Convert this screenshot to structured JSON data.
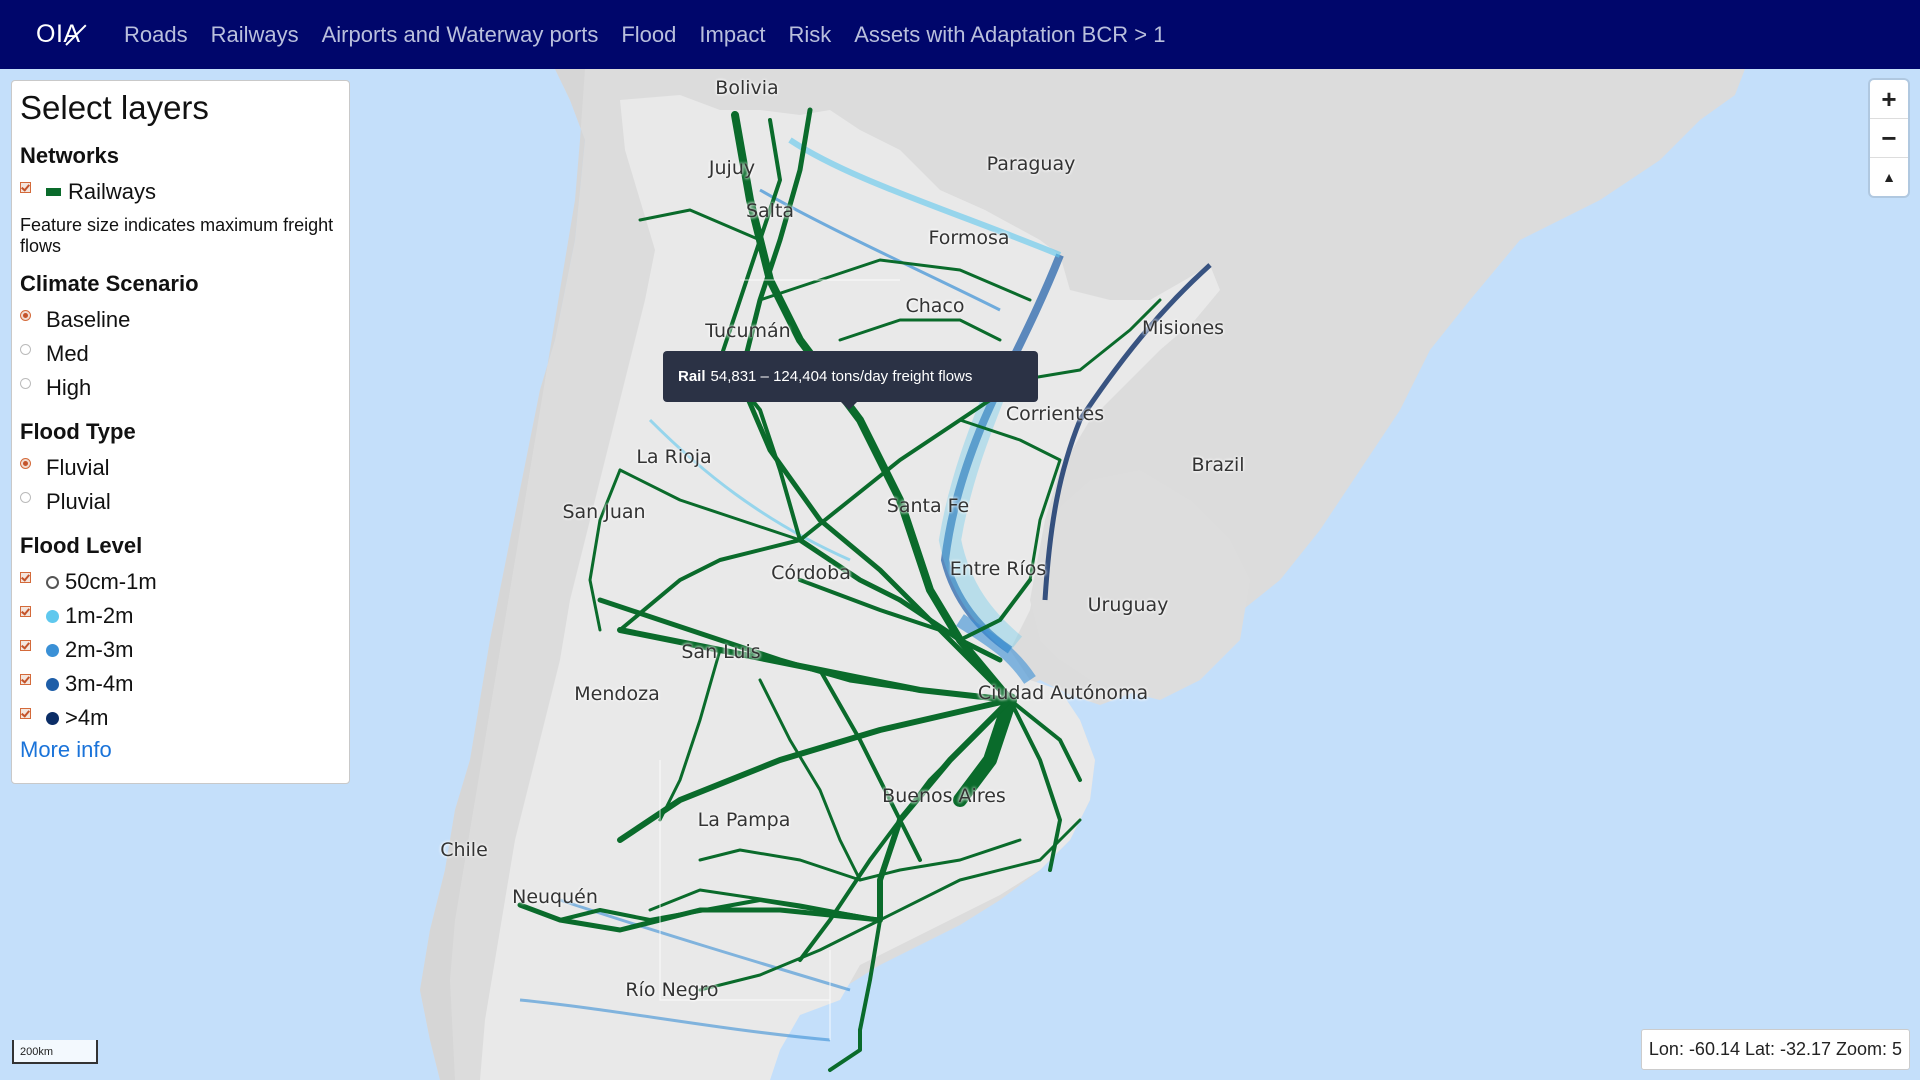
{
  "navbar": {
    "brand": "OIA",
    "links": [
      "Roads",
      "Railways",
      "Airports and Waterway ports",
      "Flood",
      "Impact",
      "Risk",
      "Assets with Adaptation BCR > 1"
    ]
  },
  "panel": {
    "title": "Select layers",
    "networks_heading": "Networks",
    "railways_label": "Railways",
    "railways_checked": true,
    "feature_note": "Feature size indicates maximum freight flows",
    "climate_heading": "Climate Scenario",
    "climate_options": [
      {
        "label": "Baseline",
        "selected": true
      },
      {
        "label": "Med",
        "selected": false
      },
      {
        "label": "High",
        "selected": false
      }
    ],
    "flood_type_heading": "Flood Type",
    "flood_type_options": [
      {
        "label": "Fluvial",
        "selected": true
      },
      {
        "label": "Pluvial",
        "selected": false
      }
    ],
    "flood_level_heading": "Flood Level",
    "flood_levels": [
      {
        "label": "50cm-1m",
        "color": "#ffffff",
        "checked": true
      },
      {
        "label": "1m-2m",
        "color": "#5fc8ee",
        "checked": true
      },
      {
        "label": "2m-3m",
        "color": "#3a90d6",
        "checked": true
      },
      {
        "label": "3m-4m",
        "color": "#1e5ea8",
        "checked": true
      },
      {
        "label": ">4m",
        "color": "#0b2d66",
        "checked": true
      }
    ],
    "more_info": "More info"
  },
  "zoom_controls": {
    "zoom_in": "+",
    "zoom_out": "−",
    "compass": "▲"
  },
  "tooltip": {
    "label": "Rail",
    "text": "54,831 – 124,404 tons/day freight flows"
  },
  "scale_bar": "200km",
  "coordinates": "Lon: -60.14 Lat: -32.17 Zoom: 5",
  "map_labels": {
    "bolivia": "Bolivia",
    "paraguay": "Paraguay",
    "jujuy": "Jujuy",
    "salta": "Salta",
    "formosa": "Formosa",
    "chaco": "Chaco",
    "tucuman": "Tucumán",
    "misiones": "Misiones",
    "corrientes": "Corrientes",
    "brazil": "Brazil",
    "la_rioja": "La Rioja",
    "santa_fe": "Santa Fe",
    "san_juan": "San Juan",
    "entre_rios": "Entre Ríos",
    "cordoba": "Córdoba",
    "uruguay": "Uruguay",
    "san_luis": "San Luis",
    "ciudad_autonoma": "Ciudad Autónoma",
    "mendoza": "Mendoza",
    "buenos_aires": "Buenos Aires",
    "la_pampa": "La Pampa",
    "chile": "Chile",
    "neuquen": "Neuquén",
    "rio_negro": "Río Negro"
  },
  "colors": {
    "navbar": "#00066b",
    "water": "#c4dffa",
    "land": "#dcdcdc",
    "argentina": "#e8e8e8",
    "rail": "#0a6b2b",
    "accent": "#d46a3a"
  }
}
